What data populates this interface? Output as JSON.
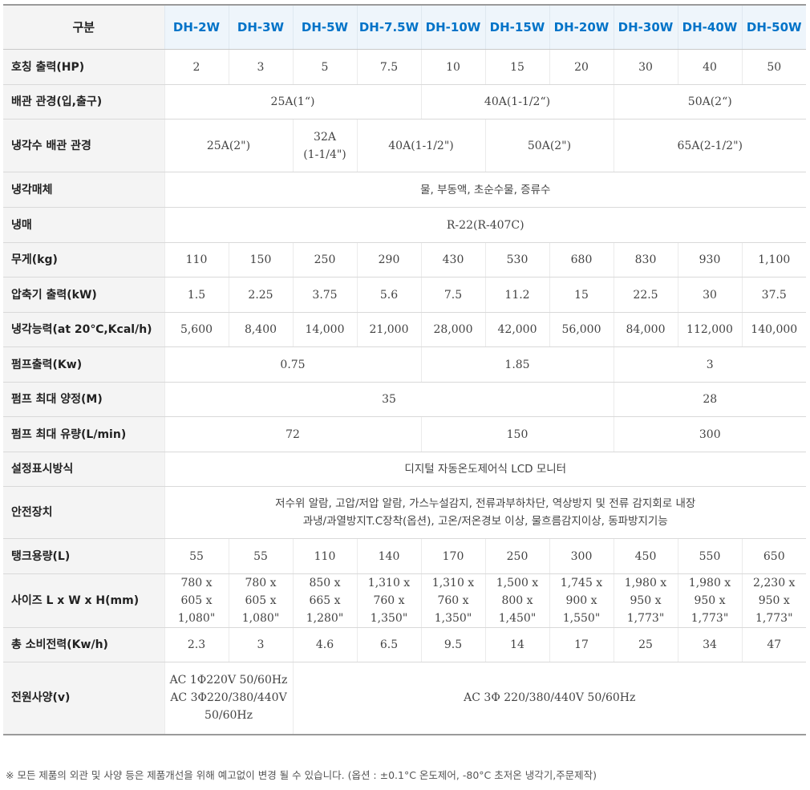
{
  "corner_label": "구분",
  "models": [
    "DH-2W",
    "DH-3W",
    "DH-5W",
    "DH-7.5W",
    "DH-10W",
    "DH-15W",
    "DH-20W",
    "DH-30W",
    "DH-40W",
    "DH-50W"
  ],
  "rows": [
    {
      "label": "호칭 출력(HP)",
      "cells": [
        {
          "text": "2"
        },
        {
          "text": "3"
        },
        {
          "text": "5"
        },
        {
          "text": "7.5"
        },
        {
          "text": "10"
        },
        {
          "text": "15"
        },
        {
          "text": "20"
        },
        {
          "text": "30"
        },
        {
          "text": "40"
        },
        {
          "text": "50"
        }
      ]
    },
    {
      "label": "배관 관경(입,출구)",
      "cells": [
        {
          "text": "25A(1“)",
          "span": 4
        },
        {
          "text": "40A(1-1/2“)",
          "span": 3
        },
        {
          "text": "50A(2“)",
          "span": 3
        }
      ]
    },
    {
      "label": "냉각수 배관 관경",
      "cells": [
        {
          "text": "25A(2\")",
          "span": 2
        },
        {
          "text": "32A\n(1-1/4\")"
        },
        {
          "text": "40A(1-1/2\")",
          "span": 2
        },
        {
          "text": "50A(2\")",
          "span": 2
        },
        {
          "text": "65A(2-1/2\")",
          "span": 3
        }
      ]
    },
    {
      "label": "냉각매체",
      "cells": [
        {
          "text": "물, 부동액, 초순수물, 증류수",
          "span": 10,
          "sans": true
        }
      ]
    },
    {
      "label": "냉매",
      "cells": [
        {
          "text": "R-22(R-407C)",
          "span": 10
        }
      ]
    },
    {
      "label": "무게(kg)",
      "cells": [
        {
          "text": "110"
        },
        {
          "text": "150"
        },
        {
          "text": "250"
        },
        {
          "text": "290"
        },
        {
          "text": "430"
        },
        {
          "text": "530"
        },
        {
          "text": "680"
        },
        {
          "text": "830"
        },
        {
          "text": "930"
        },
        {
          "text": "1,100"
        }
      ]
    },
    {
      "label": "압축기 출력(kW)",
      "cells": [
        {
          "text": "1.5"
        },
        {
          "text": "2.25"
        },
        {
          "text": "3.75"
        },
        {
          "text": "5.6"
        },
        {
          "text": "7.5"
        },
        {
          "text": "11.2"
        },
        {
          "text": "15"
        },
        {
          "text": "22.5"
        },
        {
          "text": "30"
        },
        {
          "text": "37.5"
        }
      ]
    },
    {
      "label": "냉각능력(at 20℃,Kcal/h)",
      "cells": [
        {
          "text": "5,600"
        },
        {
          "text": "8,400"
        },
        {
          "text": "14,000"
        },
        {
          "text": "21,000"
        },
        {
          "text": "28,000"
        },
        {
          "text": "42,000"
        },
        {
          "text": "56,000"
        },
        {
          "text": "84,000"
        },
        {
          "text": "112,000"
        },
        {
          "text": "140,000"
        }
      ]
    },
    {
      "label": "펌프출력(Kw)",
      "cells": [
        {
          "text": "0.75",
          "span": 4
        },
        {
          "text": "1.85",
          "span": 3
        },
        {
          "text": "3",
          "span": 3
        }
      ]
    },
    {
      "label": "펌프 최대 양정(M)",
      "cells": [
        {
          "text": "35",
          "span": 7
        },
        {
          "text": "28",
          "span": 3
        }
      ]
    },
    {
      "label": "펌프 최대 유량(L/min)",
      "cells": [
        {
          "text": "72",
          "span": 4
        },
        {
          "text": "150",
          "span": 3
        },
        {
          "text": "300",
          "span": 3
        }
      ]
    },
    {
      "label": "설정표시방식",
      "cells": [
        {
          "text": "디지털 자동온도제어식 LCD 모니터",
          "span": 10,
          "sans": true
        }
      ]
    },
    {
      "label": "안전장치",
      "cells": [
        {
          "text": "저수위 알람, 고압/저압 알람, 가스누설감지, 전류과부하차단, 역상방지 및 전류 감지회로 내장\n과냉/과열방지T.C장착(옵션), 고온/저온경보 이상, 물흐름감지이상, 동파방지기능",
          "span": 10,
          "sans": true
        }
      ]
    },
    {
      "label": "탱크용량(L)",
      "cells": [
        {
          "text": "55"
        },
        {
          "text": "55"
        },
        {
          "text": "110"
        },
        {
          "text": "140"
        },
        {
          "text": "170"
        },
        {
          "text": "250"
        },
        {
          "text": "300"
        },
        {
          "text": "450"
        },
        {
          "text": "550"
        },
        {
          "text": "650"
        }
      ]
    },
    {
      "label": "사이즈 L x W x H(mm)",
      "cells": [
        {
          "text": "780 x\n605 x\n1,080\""
        },
        {
          "text": "780 x\n605 x\n1,080\""
        },
        {
          "text": "850 x\n665 x\n1,280\""
        },
        {
          "text": "1,310 x\n760 x\n1,350\""
        },
        {
          "text": "1,310 x\n760 x\n1,350\""
        },
        {
          "text": "1,500 x\n800 x\n1,450\""
        },
        {
          "text": "1,745 x\n900 x\n1,550\""
        },
        {
          "text": "1,980 x\n950 x\n1,773\""
        },
        {
          "text": "1,980 x\n950 x\n1,773\""
        },
        {
          "text": "2,230 x\n950 x\n1,773\""
        }
      ]
    },
    {
      "label": "총 소비전력(Kw/h)",
      "cells": [
        {
          "text": "2.3"
        },
        {
          "text": "3"
        },
        {
          "text": "4.6"
        },
        {
          "text": "6.5"
        },
        {
          "text": "9.5"
        },
        {
          "text": "14"
        },
        {
          "text": "17"
        },
        {
          "text": "25"
        },
        {
          "text": "34"
        },
        {
          "text": "47"
        }
      ]
    },
    {
      "label": "전원사양(v)",
      "cells": [
        {
          "text": "AC 1Φ220V 50/60Hz\nAC 3Φ220/380/440V\n50/60Hz",
          "span": 2
        },
        {
          "text": "AC 3Φ 220/380/440V 50/60Hz",
          "span": 8
        }
      ]
    }
  ],
  "footnote": "※ 모든 제품의 외관 및 사양 등은 제품개선을 위해 예고없이 변경 될 수 있습니다. (옵션 : ±0.1°C 온도제어, -80°C 초저온 냉각기,주문제작)"
}
